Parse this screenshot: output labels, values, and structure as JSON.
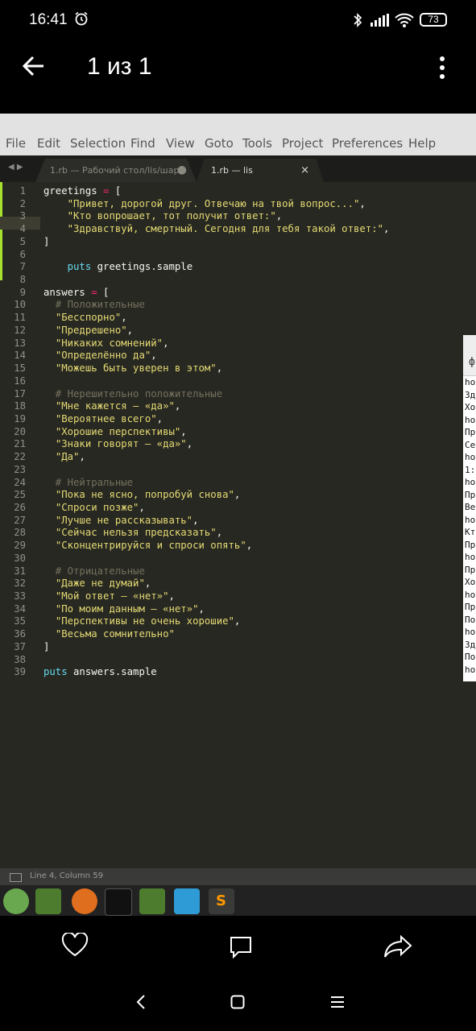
{
  "status": {
    "time": "16:41",
    "battery": "73"
  },
  "header": {
    "title": "1 из 1"
  },
  "menu": [
    "File",
    "Edit",
    "Selection",
    "Find",
    "View",
    "Goto",
    "Tools",
    "Project",
    "Preferences",
    "Help"
  ],
  "tabs": [
    {
      "label": "1.rb — Рабочий стол/lis/шар",
      "close": "●"
    },
    {
      "label": "1.rb — lis",
      "close": "×"
    }
  ],
  "code_lines": [
    "greetings = [",
    "    \"Привет, дорогой друг. Отвечаю на твой вопрос...\",",
    "    \"Кто вопрошает, тот получит ответ:\",",
    "    \"Здравствуй, смертный. Сегодня для тебя такой ответ:\",",
    "]",
    "",
    "    puts greetings.sample",
    "",
    "answers = [",
    "  # Положительные",
    "  \"Бесспорно\",",
    "  \"Предрешено\",",
    "  \"Никаких сомнений\",",
    "  \"Определённо да\",",
    "  \"Можешь быть уверен в этом\",",
    "",
    "  # Нерешительно положительные",
    "  \"Мне кажется — «да»\",",
    "  \"Вероятнее всего\",",
    "  \"Хорошие перспективы\",",
    "  \"Знаки говорят — «да»\",",
    "  \"Да\",",
    "",
    "  # Нейтральные",
    "  \"Пока не ясно, попробуй снова\",",
    "  \"Спроси позже\",",
    "  \"Лучше не рассказывать\",",
    "  \"Сейчас нельзя предсказать\",",
    "  \"Сконцентрируйся и спроси опять\",",
    "",
    "  # Отрицательные",
    "  \"Даже не думай\",",
    "  \"Мой ответ — «нет»\",",
    "  \"По моим данным — «нет»\",",
    "  \"Перспективы не очень хорошие\",",
    "  \"Весьма сомнительно\"",
    "]",
    "",
    "puts answers.sample"
  ],
  "side_panel": {
    "header": "ф",
    "rows": [
      "ho",
      "Зд",
      "Хо",
      "ho",
      "Пр",
      "Се",
      "ho",
      "1:",
      "ho",
      "Пр",
      "Ве",
      "ho",
      "Кт",
      "Пр",
      "ho",
      "Пр",
      "Хо",
      "ho",
      "Пр",
      "По",
      "ho",
      "Зд",
      "По",
      "ho"
    ]
  },
  "editor_status": "Line 4, Column 59",
  "colors": {
    "editor_bg": "#272822",
    "string": "#e6db74",
    "keyword": "#66d9ef",
    "operator": "#f92672",
    "comment": "#75715e"
  }
}
